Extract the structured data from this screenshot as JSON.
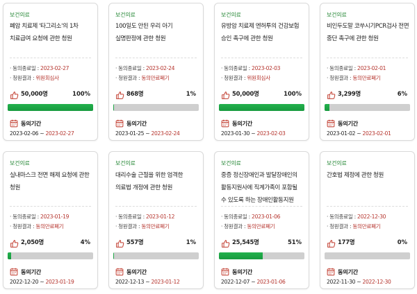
{
  "labels": {
    "end_date": "동의종료일 : ",
    "result": "청원결과 : ",
    "period": "동의기간",
    "tilde": " ~ "
  },
  "colors": {
    "category": "#2a8a3a",
    "accent_red": "#b5332c",
    "progress_fill": "#1fa847",
    "progress_track": "#cfcfcf"
  },
  "icons": {
    "count": "thumbs-up-icon",
    "period": "calendar-icon"
  },
  "cards": [
    {
      "category": "보건의료",
      "title": "폐암 치료제 '타그리소'의 1차 치료급여 요청에 관한 청원",
      "end_date": "2023-02-27",
      "result": "위원회심사",
      "count": "50,000명",
      "percent": "100%",
      "progress": 100,
      "period_start": "2023-02-06",
      "period_end": "2023-02-27"
    },
    {
      "category": "보건의료",
      "title": "100일도 안된 우리 아기 실명판정에 관한 청원",
      "end_date": "2023-02-24",
      "result": "동의만료폐기",
      "count": "868명",
      "percent": "1%",
      "progress": 1,
      "period_start": "2023-01-25",
      "period_end": "2023-02-24"
    },
    {
      "category": "보건의료",
      "title": "유방암 치료제 엔허투의 건강보험 승인 촉구에 관한 청원",
      "end_date": "2023-02-03",
      "result": "위원회심사",
      "count": "50,000명",
      "percent": "100%",
      "progress": 100,
      "period_start": "2023-01-30",
      "period_end": "2023-02-03"
    },
    {
      "category": "보건의료",
      "title": "비인두도말 코쑤시기PCR검사 전면 중단 촉구에 관한 청원",
      "end_date": "2023-02-01",
      "result": "동의만료폐기",
      "count": "3,299명",
      "percent": "6%",
      "progress": 6,
      "period_start": "2023-01-02",
      "period_end": "2023-02-01"
    },
    {
      "category": "보건의료",
      "title": "실내마스크 전면 해제 요청에 관한 청원",
      "end_date": "2023-01-19",
      "result": "동의만료폐기",
      "count": "2,050명",
      "percent": "4%",
      "progress": 4,
      "period_start": "2022-12-20",
      "period_end": "2023-01-19"
    },
    {
      "category": "보건의료",
      "title": "대리수술 근절을 위한 엄격한 의료법 개정에 관한 청원",
      "end_date": "2023-01-12",
      "result": "동의만료폐기",
      "count": "557명",
      "percent": "1%",
      "progress": 1,
      "period_start": "2022-12-13",
      "period_end": "2023-01-12"
    },
    {
      "category": "보건의료",
      "title": "중증 정신장애인과 발달장애인의 활동지원사에 직계가족이 포함될 수 있도록 하는 장애인활동지원",
      "end_date": "2023-01-06",
      "result": "동의만료폐기",
      "count": "25,545명",
      "percent": "51%",
      "progress": 51,
      "period_start": "2022-12-07",
      "period_end": "2023-01-06"
    },
    {
      "category": "보건의료",
      "title": "간호법 제정에 관한 청원",
      "end_date": "2022-12-30",
      "result": "동의만료폐기",
      "count": "177명",
      "percent": "0%",
      "progress": 0,
      "period_start": "2022-11-30",
      "period_end": "2022-12-30"
    }
  ]
}
